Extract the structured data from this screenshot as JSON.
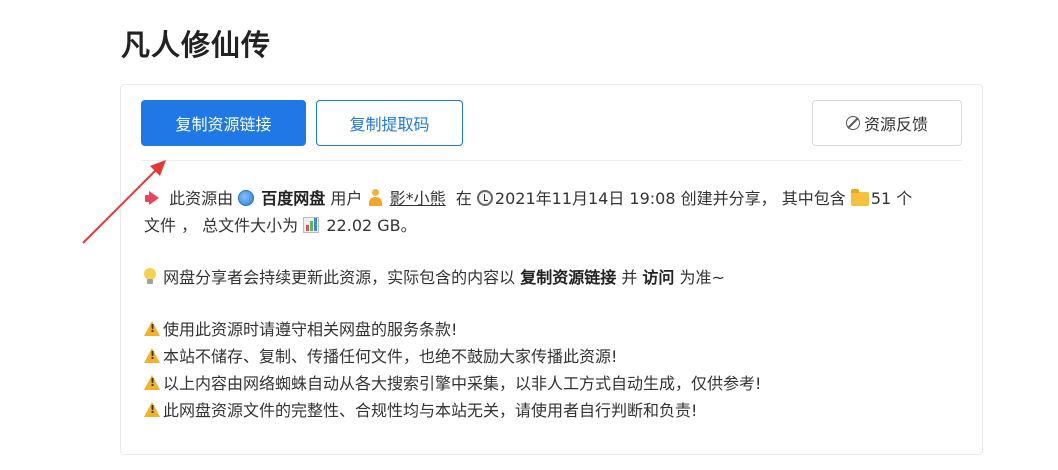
{
  "title": "凡人修仙传",
  "toolbar": {
    "copy_link_label": "复制资源链接",
    "copy_code_label": "复制提取码",
    "feedback_label": "资源反馈"
  },
  "info": {
    "prefix": "此资源由",
    "platform": "百度网盘",
    "user_word": "用户",
    "username": "影*小熊",
    "at_word": "在",
    "datetime": "2021年11月14日 19:08",
    "created_text": "创建并分享， 其中包含",
    "file_count": "51",
    "count_unit": "个",
    "line2_prefix": "文件 ，  总文件大小为",
    "total_size": "22.02 GB。"
  },
  "notice": {
    "text1": "网盘分享者会持续更新此资源，实际包含的内容以",
    "bold1": "复制资源链接",
    "text2": "并",
    "bold2": "访问",
    "text3": "为准~"
  },
  "warnings": [
    "使用此资源时请遵守相关网盘的服务条款!",
    "本站不储存、复制、传播任何文件，也绝不鼓励大家传播此资源!",
    "以上内容由网络蜘蛛自动从各大搜索引擎中采集，以非人工方式自动生成，仅供参考!",
    "此网盘资源文件的完整性、合规性均与本站无关，请使用者自行判断和负责!"
  ],
  "colors": {
    "primary": "#1f78e6",
    "arrow": "#e53935",
    "warning": "#f6b12b"
  }
}
